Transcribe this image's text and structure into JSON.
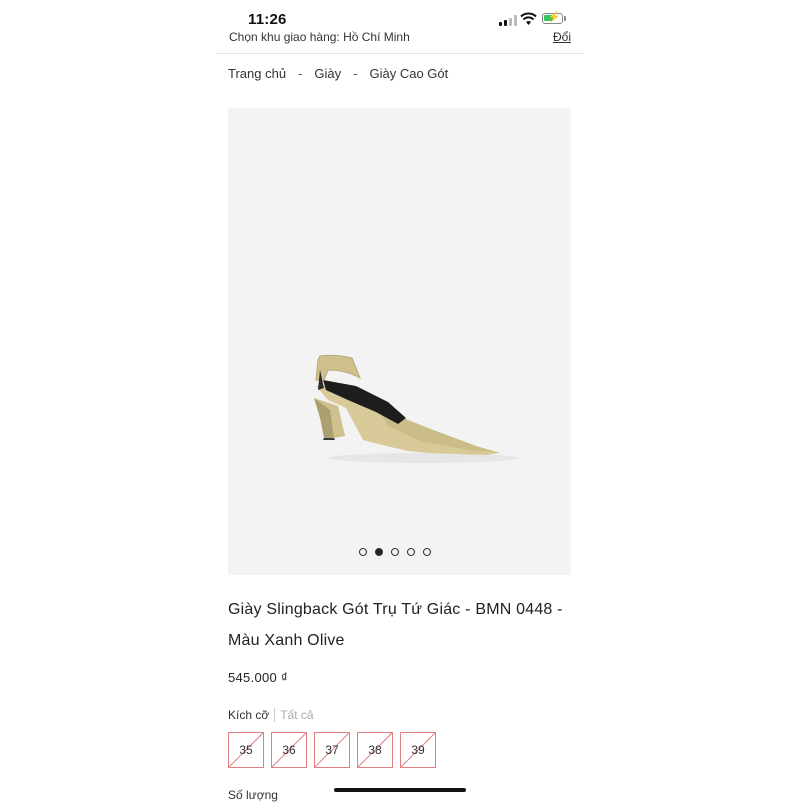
{
  "status_bar": {
    "time": "11:26",
    "battery_color": "#3cc35a"
  },
  "delivery_bar": {
    "text": "Chọn khu giao hàng: Hồ Chí Minh",
    "change_label": "Đổi"
  },
  "breadcrumb": {
    "items": [
      "Trang chủ",
      "Giày",
      "Giày Cao Gót"
    ],
    "separator": "-"
  },
  "gallery": {
    "image_alt": "olive slingback pointed-toe shoe with block heel",
    "slide_count": 5,
    "active_slide": 2
  },
  "product": {
    "title": "Giày Slingback Gót Trụ Tứ Giác - BMN 0448 - Màu Xanh Olive",
    "price": "545.000 ₫"
  },
  "size_selector": {
    "label": "Kích cỡ",
    "all_label": "Tất cả",
    "options": [
      {
        "value": "35",
        "available": false
      },
      {
        "value": "36",
        "available": false
      },
      {
        "value": "37",
        "available": false
      },
      {
        "value": "38",
        "available": false
      },
      {
        "value": "39",
        "available": false
      }
    ],
    "unavailable_color": "#e08080"
  },
  "quantity": {
    "label": "Số lượng"
  }
}
